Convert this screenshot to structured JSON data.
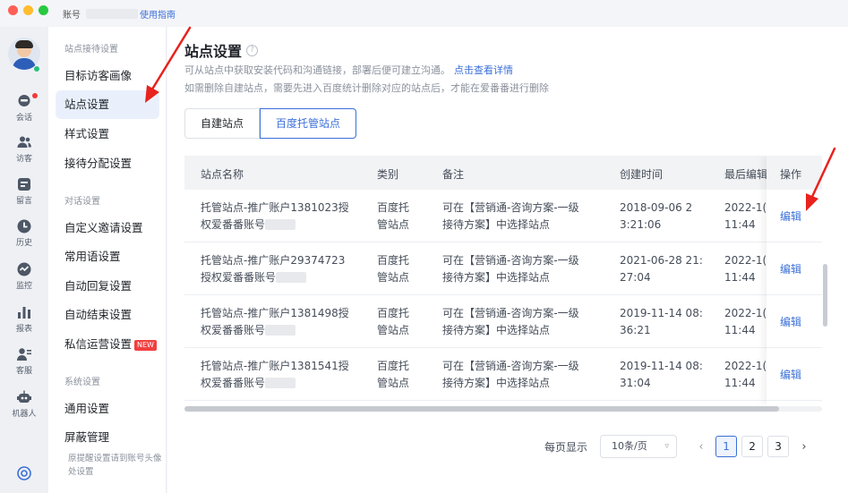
{
  "topbar": {
    "account_label": "账号",
    "guide_link": "使用指南"
  },
  "window_controls": [
    {
      "name": "close",
      "color": "#fe5f57"
    },
    {
      "name": "minimize",
      "color": "#febc2e"
    },
    {
      "name": "zoom",
      "color": "#28c840"
    }
  ],
  "rail": {
    "items": [
      {
        "label": "会话",
        "icon": "chat-icon"
      },
      {
        "label": "访客",
        "icon": "visitors-icon"
      },
      {
        "label": "留言",
        "icon": "message-icon"
      },
      {
        "label": "历史",
        "icon": "history-icon"
      },
      {
        "label": "监控",
        "icon": "monitor-icon"
      },
      {
        "label": "报表",
        "icon": "report-icon"
      },
      {
        "label": "客服",
        "icon": "agent-icon"
      },
      {
        "label": "机器人",
        "icon": "robot-icon"
      }
    ]
  },
  "sidebar": {
    "group1": "站点接待设置",
    "group2": "对话设置",
    "group3": "系统设置",
    "items": [
      "目标访客画像",
      "站点设置",
      "样式设置",
      "接待分配设置",
      "自定义邀请设置",
      "常用语设置",
      "自动回复设置",
      "自动结束设置",
      "私信运营设置",
      "通用设置",
      "屏蔽管理"
    ],
    "new_badge": "NEW",
    "note": "原提醒设置请到账号头像处设置"
  },
  "page": {
    "title": "站点设置",
    "help_icon": "?",
    "desc1": "可从站点中获取安装代码和沟通链接，部署后便可建立沟通。",
    "desc1_link": "点击查看详情",
    "desc2": "如需删除自建站点，需要先进入百度统计删除对应的站点后，才能在爱番番进行删除",
    "tabs": [
      "自建站点",
      "百度托管站点"
    ]
  },
  "table": {
    "headers": [
      "站点名称",
      "类别",
      "备注",
      "创建时间",
      "最后编辑",
      "操作"
    ],
    "rows": [
      {
        "name1": "托管站点-推广账户1381023授",
        "name2": "权爱番番账号",
        "type1": "百度托",
        "type2": "管站点",
        "note1": "可在【营销通-咨询方案-一级",
        "note2": "接待方案】中选择站点",
        "time1": "2018-09-06 2",
        "time2": "3:21:06",
        "last1": "2022-1(",
        "last2": "11:44",
        "action": "编辑"
      },
      {
        "name1": "托管站点-推广账户29374723",
        "name2": "授权爱番番账号",
        "type1": "百度托",
        "type2": "管站点",
        "note1": "可在【营销通-咨询方案-一级",
        "note2": "接待方案】中选择站点",
        "time1": "2021-06-28 21:",
        "time2": "27:04",
        "last1": "2022-1(",
        "last2": "11:44",
        "action": "编辑"
      },
      {
        "name1": "托管站点-推广账户1381498授",
        "name2": "权爱番番账号",
        "type1": "百度托",
        "type2": "管站点",
        "note1": "可在【营销通-咨询方案-一级",
        "note2": "接待方案】中选择站点",
        "time1": "2019-11-14 08:",
        "time2": "36:21",
        "last1": "2022-1(",
        "last2": "11:44",
        "action": "编辑"
      },
      {
        "name1": "托管站点-推广账户1381541授",
        "name2": "权爱番番账号",
        "type1": "百度托",
        "type2": "管站点",
        "note1": "可在【营销通-咨询方案-一级",
        "note2": "接待方案】中选择站点",
        "time1": "2019-11-14 08:",
        "time2": "31:04",
        "last1": "2022-1(",
        "last2": "11:44",
        "action": "编辑"
      }
    ]
  },
  "pagination": {
    "page_size_label": "每页显示",
    "page_size_value": "10条/页",
    "prev": "‹",
    "next": "›",
    "pages": [
      "1",
      "2",
      "3"
    ],
    "current": "1"
  },
  "colors": {
    "accent": "#3b6fd8",
    "annotation_arrow": "#e8221c"
  }
}
